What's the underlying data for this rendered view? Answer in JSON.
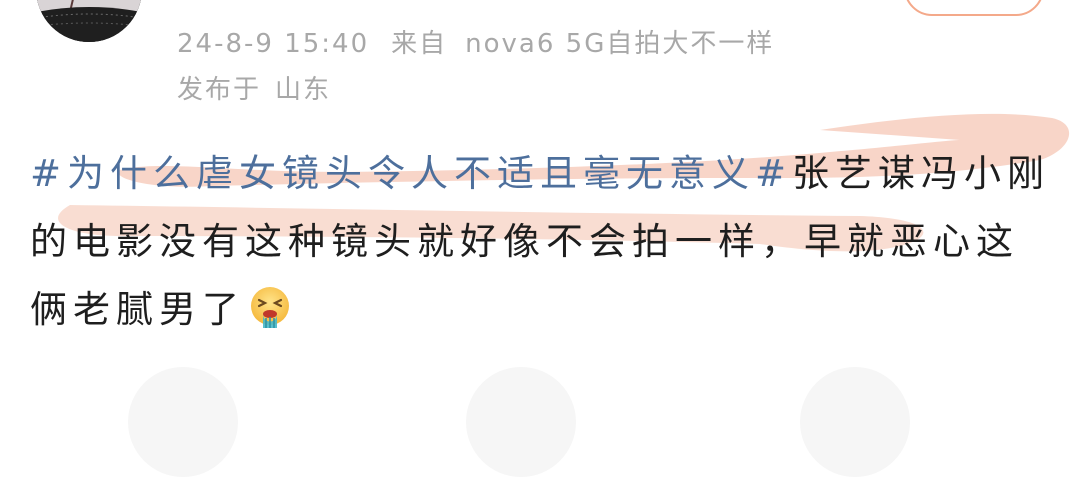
{
  "post": {
    "timestamp": "24-8-9 15:40",
    "source_prefix": "来自",
    "source_device": "nova6 5G自拍大不一样",
    "location_prefix": "发布于",
    "location": "山东",
    "hashtag": "#为什么虐女镜头令人不适且毫无意义#",
    "body_text": "张艺谋冯小刚的电影没有这种镜头就好像不会拍一样，早就恶心这俩老腻男了",
    "emoji": "vomit-emoji"
  },
  "colors": {
    "hashtag": "#4d6f9c",
    "meta": "#a8a8a8",
    "highlighter": "#f2b39b",
    "follow_border": "#f4a98a"
  }
}
